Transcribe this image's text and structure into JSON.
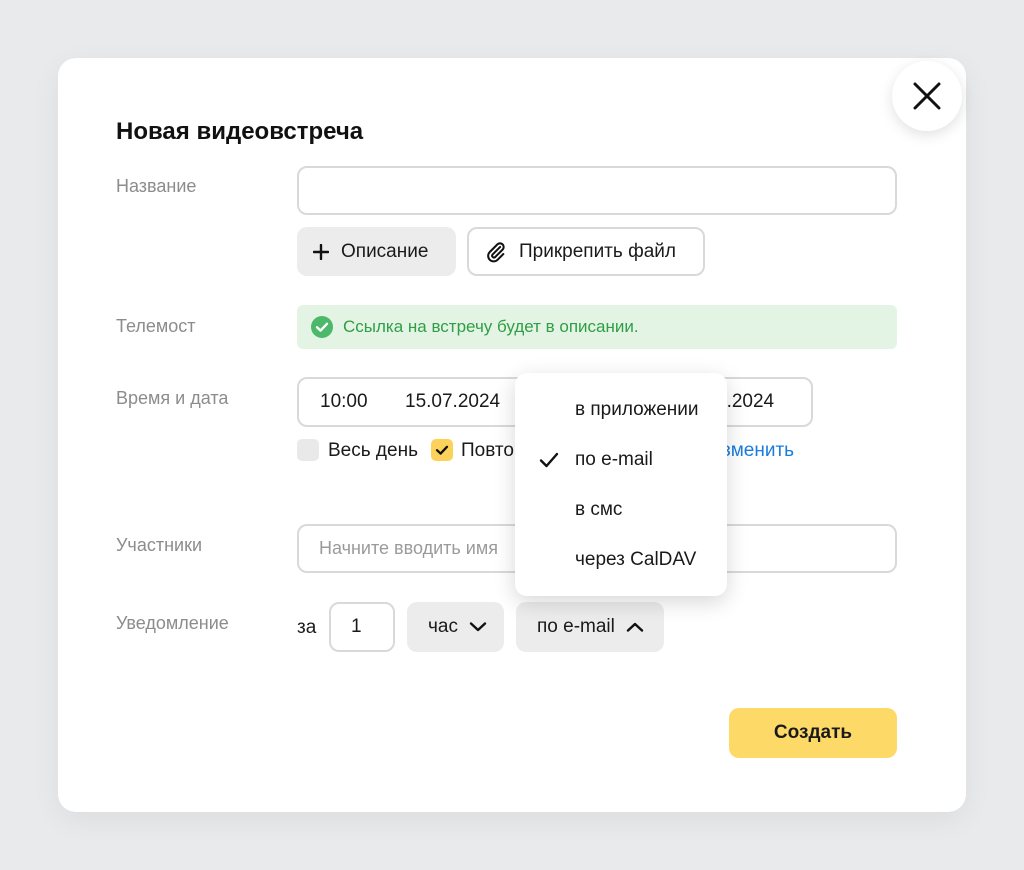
{
  "modal": {
    "title": "Новая видеовстреча"
  },
  "fields": {
    "name_label": "Название",
    "name_value": "",
    "telemost_label": "Телемост",
    "datetime_label": "Время и дата",
    "participants_label": "Участники",
    "participants_placeholder": "Начните вводить имя",
    "notification_label": "Уведомление"
  },
  "buttons": {
    "description": "Описание",
    "attach_file": "Прикрепить файл",
    "create": "Создать"
  },
  "notice": {
    "text": "Ссылка на встречу будет в описании.",
    "color": "#2f9e44"
  },
  "datetime": {
    "start_time": "10:00",
    "start_date": "15.07.2024",
    "end_date_visible": "7.2024"
  },
  "options": {
    "all_day_label": "Весь день",
    "all_day_checked": false,
    "repeat_label": "Повто",
    "repeat_checked": true,
    "change_link": "зменить"
  },
  "notification": {
    "prefix": "за",
    "amount": "1",
    "unit": "час",
    "method": "по e-mail"
  },
  "dropdown": {
    "items": [
      {
        "label": "в приложении",
        "selected": false
      },
      {
        "label": "по e-mail",
        "selected": true
      },
      {
        "label": "в смс",
        "selected": false
      },
      {
        "label": "через CalDAV",
        "selected": false
      }
    ]
  },
  "icons": {
    "close": "close-icon",
    "plus": "plus-icon",
    "paperclip": "paperclip-icon",
    "check_circle": "check-circle-icon",
    "chevron_down": "chevron-down-icon",
    "chevron_up": "chevron-up-icon",
    "checkmark": "checkmark-icon"
  },
  "colors": {
    "accent_yellow": "#fdda67",
    "link_blue": "#1a7ce0",
    "success_green": "#2f9e44",
    "checkbox_yellow": "#fdd25a"
  }
}
